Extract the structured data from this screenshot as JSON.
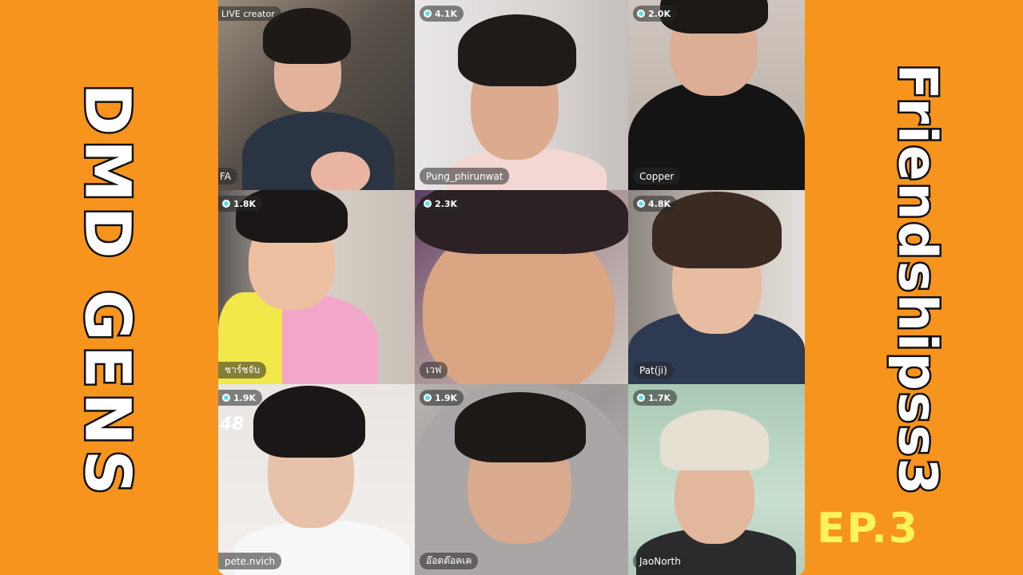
{
  "left_title": "DMD GENS",
  "right_title": "Friendshipss3",
  "episode": "EP.3",
  "colors": {
    "background": "#f7941d",
    "episode_text": "#fff35a",
    "viewer_dot": "#5ee0e8"
  },
  "tiles": [
    {
      "name": "FA",
      "badge": "LIVE creator",
      "viewers": null,
      "icon": "person-icon"
    },
    {
      "name": "Pung_phirunwat",
      "badge": null,
      "viewers": "4.1K",
      "icon": "person-icon"
    },
    {
      "name": "Copper",
      "badge": null,
      "viewers": "2.0K",
      "icon": "person-icon"
    },
    {
      "name": "ชาร์ชจับ",
      "badge": null,
      "viewers": "1.8K",
      "icon": "person-icon"
    },
    {
      "name": "เวฟ",
      "badge": null,
      "viewers": "2.3K",
      "icon": "person-icon"
    },
    {
      "name": "Pat(ji)",
      "badge": null,
      "viewers": "4.8K",
      "icon": "person-icon"
    },
    {
      "name": "pete.nvich",
      "badge": null,
      "viewers": "1.9K",
      "overlay_number": "48",
      "icon": "person-icon"
    },
    {
      "name": "อ๊อดต๊อคเค",
      "badge": null,
      "viewers": "1.9K",
      "icon": "person-icon"
    },
    {
      "name": "JaoNorth",
      "badge": null,
      "viewers": "1.7K",
      "icon": "person-icon"
    }
  ]
}
